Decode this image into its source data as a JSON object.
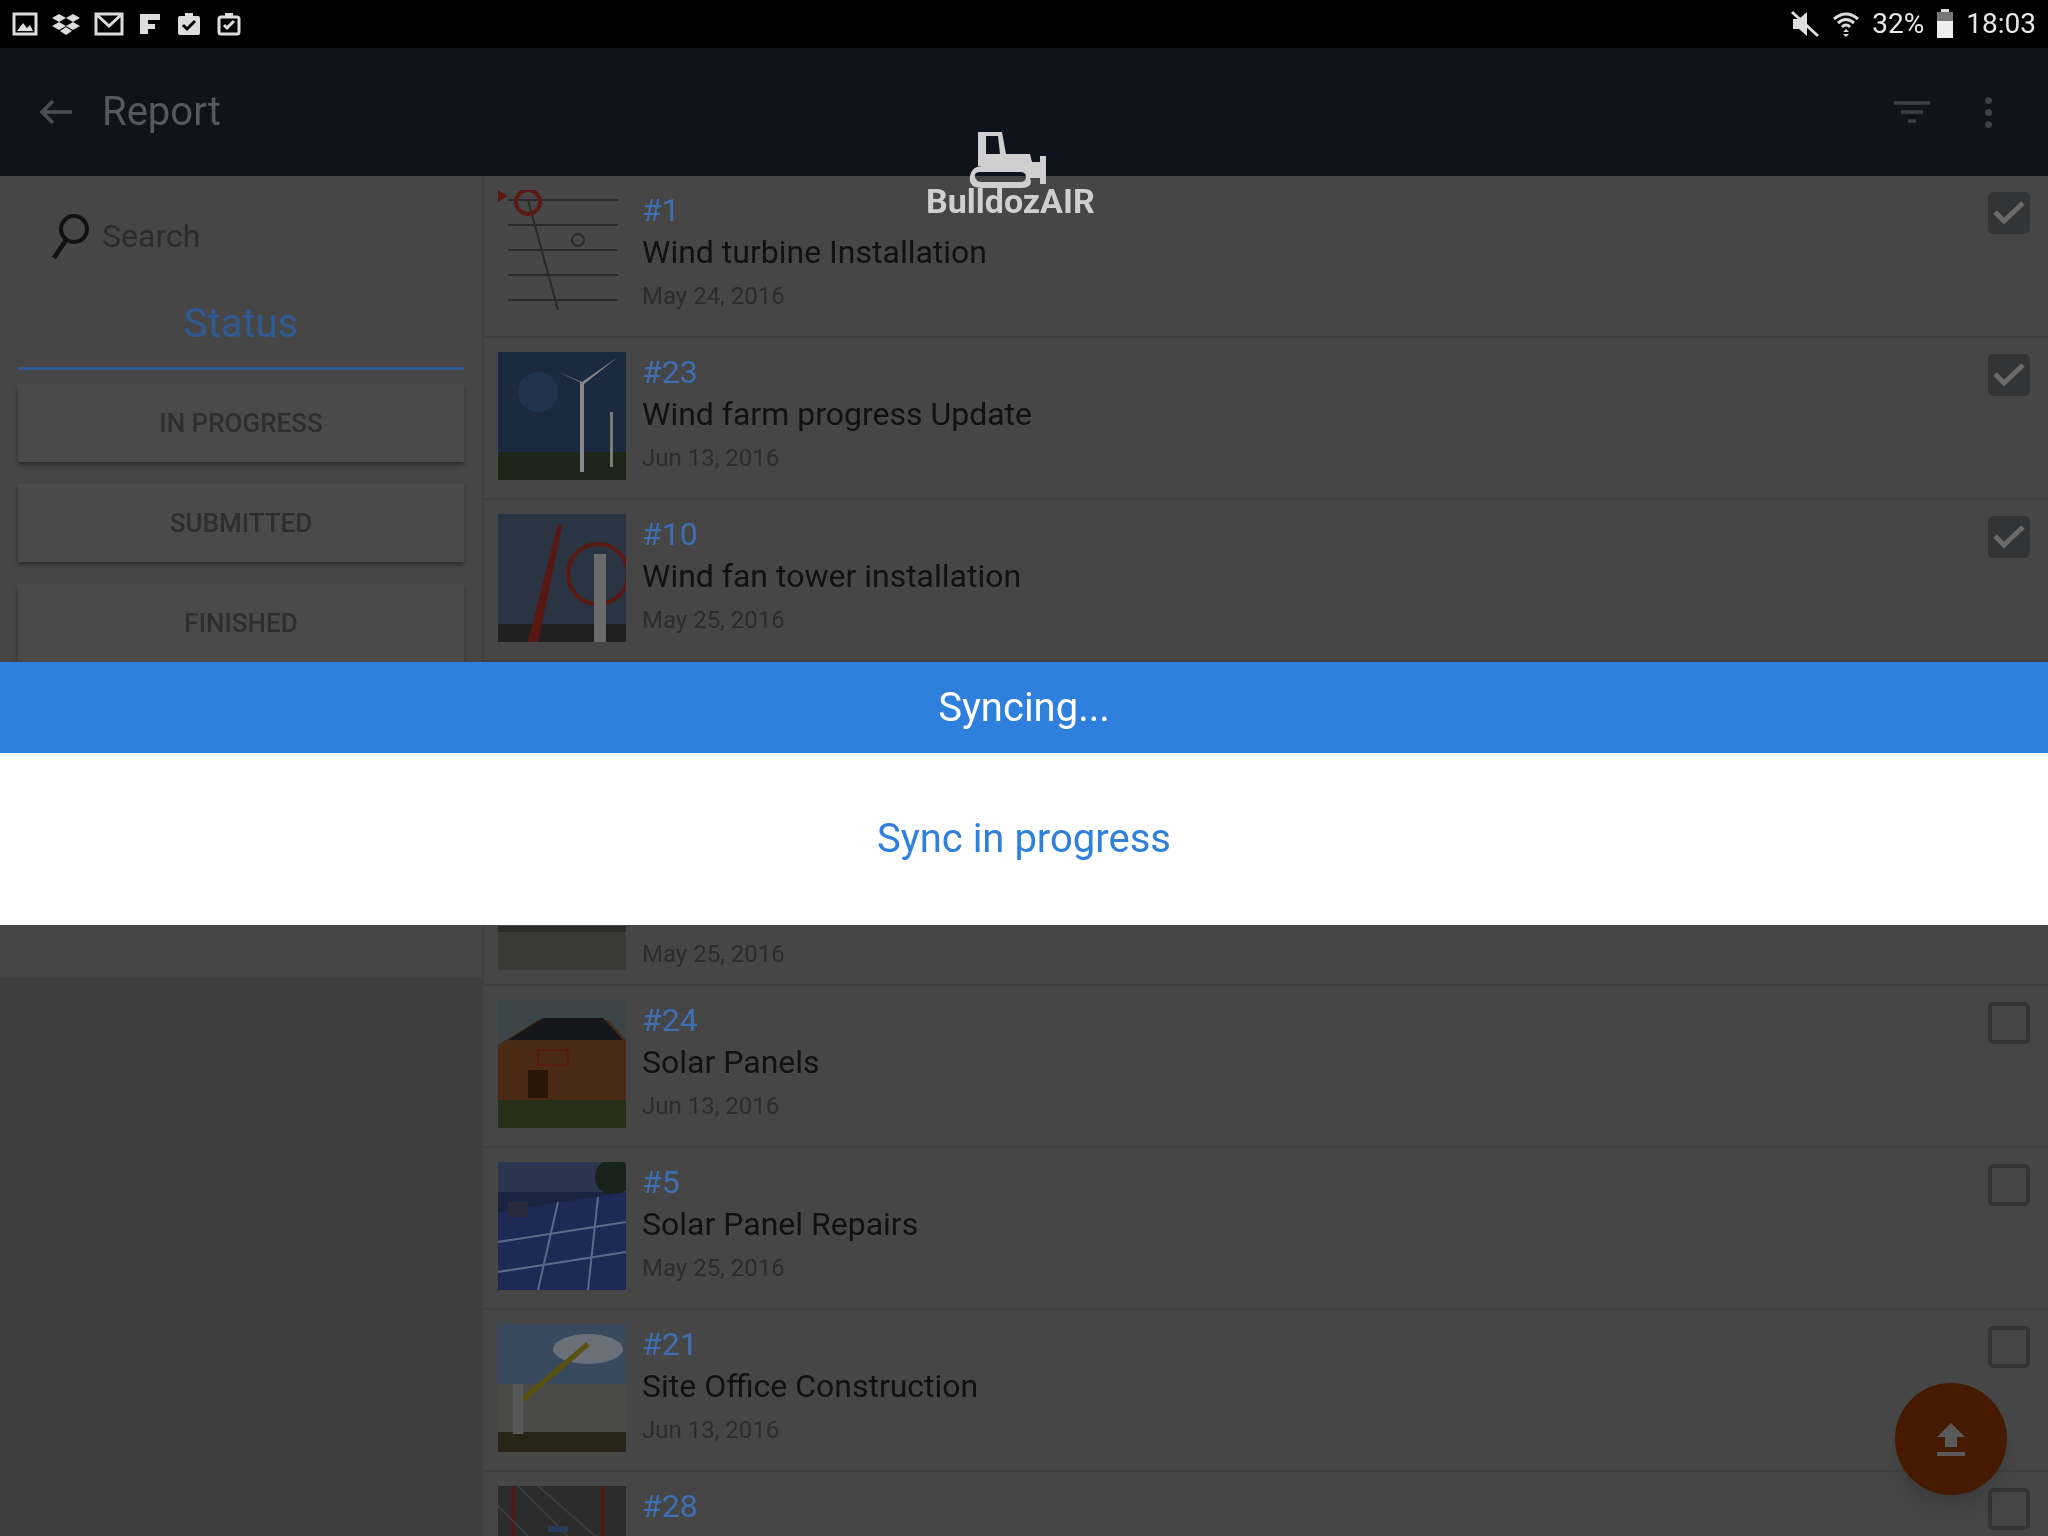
{
  "status_bar": {
    "battery": "32%",
    "time": "18:03"
  },
  "app_bar": {
    "title": "Report"
  },
  "logo": {
    "text": "BulldozAIR"
  },
  "sidebar": {
    "search": {
      "placeholder": "Search"
    },
    "tabs": [
      {
        "label": "Status",
        "selected": true
      }
    ],
    "filters": [
      "IN PROGRESS",
      "SUBMITTED",
      "FINISHED"
    ]
  },
  "reports": [
    {
      "number": "#1",
      "title": "Wind turbine Installation",
      "date": "May 24, 2016",
      "checked": true
    },
    {
      "number": "#23",
      "title": "Wind farm progress Update",
      "date": "Jun 13, 2016",
      "checked": true
    },
    {
      "number": "#10",
      "title": "Wind fan tower installation",
      "date": "May 25, 2016",
      "checked": true
    },
    {
      "date": "May 25, 2016"
    },
    {
      "number": "#24",
      "title": "Solar Panels",
      "date": "Jun 13, 2016",
      "checked": false
    },
    {
      "number": "#5",
      "title": "Solar Panel Repairs",
      "date": "May 25, 2016",
      "checked": false
    },
    {
      "number": "#21",
      "title": "Site Office Construction",
      "date": "Jun 13, 2016",
      "checked": false
    },
    {
      "number": "#28",
      "checked": false
    }
  ],
  "dialog": {
    "title": "Syncing...",
    "message": "Sync in progress"
  }
}
